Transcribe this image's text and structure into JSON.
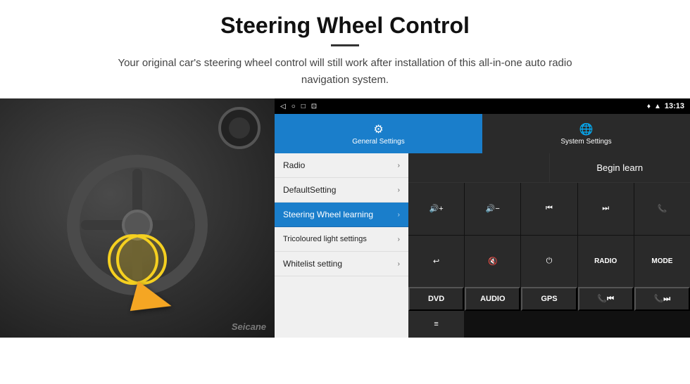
{
  "header": {
    "title": "Steering Wheel Control",
    "subtitle": "Your original car's steering wheel control will still work after installation of this all-in-one auto radio navigation system."
  },
  "status_bar": {
    "time": "13:13",
    "icons": [
      "◁",
      "○",
      "□",
      "⊡"
    ]
  },
  "tabs": [
    {
      "id": "general",
      "label": "General Settings",
      "icon": "⚙",
      "active": true
    },
    {
      "id": "system",
      "label": "System Settings",
      "icon": "🌐",
      "active": false
    }
  ],
  "menu_items": [
    {
      "label": "Radio",
      "active": false
    },
    {
      "label": "DefaultSetting",
      "active": false
    },
    {
      "label": "Steering Wheel learning",
      "active": true
    },
    {
      "label": "Tricoloured light settings",
      "active": false
    },
    {
      "label": "Whitelist setting",
      "active": false
    }
  ],
  "controls": {
    "radio_label": "",
    "begin_learn": "Begin learn",
    "buttons": [
      {
        "label": "🔊+",
        "type": "vol-up"
      },
      {
        "label": "🔊−",
        "type": "vol-down"
      },
      {
        "label": "⏮",
        "type": "prev-track"
      },
      {
        "label": "⏭",
        "type": "next-track"
      },
      {
        "label": "📞",
        "type": "phone"
      },
      {
        "label": "↩",
        "type": "back"
      },
      {
        "label": "🔇",
        "type": "mute"
      },
      {
        "label": "⏻",
        "type": "power"
      },
      {
        "label": "RADIO",
        "type": "radio"
      },
      {
        "label": "MODE",
        "type": "mode"
      },
      {
        "label": "DVD",
        "type": "dvd"
      },
      {
        "label": "AUDIO",
        "type": "audio"
      },
      {
        "label": "GPS",
        "type": "gps"
      },
      {
        "label": "📞⏮",
        "type": "phone-prev"
      },
      {
        "label": "📞⏭",
        "type": "phone-next"
      },
      {
        "label": "≡",
        "type": "menu"
      }
    ]
  },
  "watermark": "Seicane"
}
